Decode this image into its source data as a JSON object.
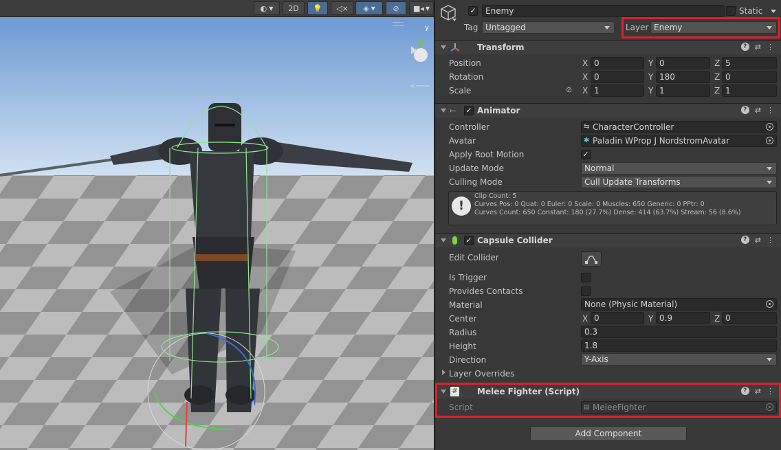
{
  "scene": {
    "toolbar": {
      "btn_2d": "2D"
    },
    "gizmo_axis_label": "y",
    "colors": {
      "sky": "#a8c6e6",
      "floor_light": "#c9c9c9",
      "floor_dark": "#9c9c9c"
    }
  },
  "header": {
    "name": "Enemy",
    "name_enabled": true,
    "static_label": "Static",
    "static_checked": false,
    "tag_label": "Tag",
    "tag_value": "Untagged",
    "layer_label": "Layer",
    "layer_value": "Enemy"
  },
  "transform": {
    "title": "Transform",
    "position": {
      "label": "Position",
      "x": "0",
      "y": "0",
      "z": "5"
    },
    "rotation": {
      "label": "Rotation",
      "x": "0",
      "y": "180",
      "z": "0"
    },
    "scale": {
      "label": "Scale",
      "x": "1",
      "y": "1",
      "z": "1"
    }
  },
  "animator": {
    "title": "Animator",
    "enabled": true,
    "controller_label": "Controller",
    "controller_value": "CharacterController",
    "avatar_label": "Avatar",
    "avatar_value": "Paladin WProp J NordstromAvatar",
    "apply_root_motion_label": "Apply Root Motion",
    "apply_root_motion": true,
    "update_mode_label": "Update Mode",
    "update_mode_value": "Normal",
    "culling_mode_label": "Culling Mode",
    "culling_mode_value": "Cull Update Transforms",
    "info": {
      "line1": "Clip Count: 5",
      "line2": "Curves Pos: 0 Quat: 0 Euler: 0 Scale: 0 Muscles: 650 Generic: 0 PPtr: 0",
      "line3": "Curves Count: 650 Constant: 180 (27.7%) Dense: 414 (63.7%) Stream: 56 (8.6%)"
    }
  },
  "capsule_collider": {
    "title": "Capsule Collider",
    "enabled": true,
    "edit_collider_label": "Edit Collider",
    "is_trigger_label": "Is Trigger",
    "is_trigger": false,
    "provides_contacts_label": "Provides Contacts",
    "provides_contacts": false,
    "material_label": "Material",
    "material_value": "None (Physic Material)",
    "center": {
      "label": "Center",
      "x": "0",
      "y": "0.9",
      "z": "0"
    },
    "radius_label": "Radius",
    "radius_value": "0.3",
    "height_label": "Height",
    "height_value": "1.8",
    "direction_label": "Direction",
    "direction_value": "Y-Axis",
    "layer_overrides_label": "Layer Overrides"
  },
  "melee_fighter": {
    "title": "Melee Fighter (Script)",
    "script_label": "Script",
    "script_value": "MeleeFighter"
  },
  "axis_labels": {
    "x": "X",
    "y": "Y",
    "z": "Z"
  },
  "add_component_label": "Add Component",
  "highlight_color": "#e0202a"
}
